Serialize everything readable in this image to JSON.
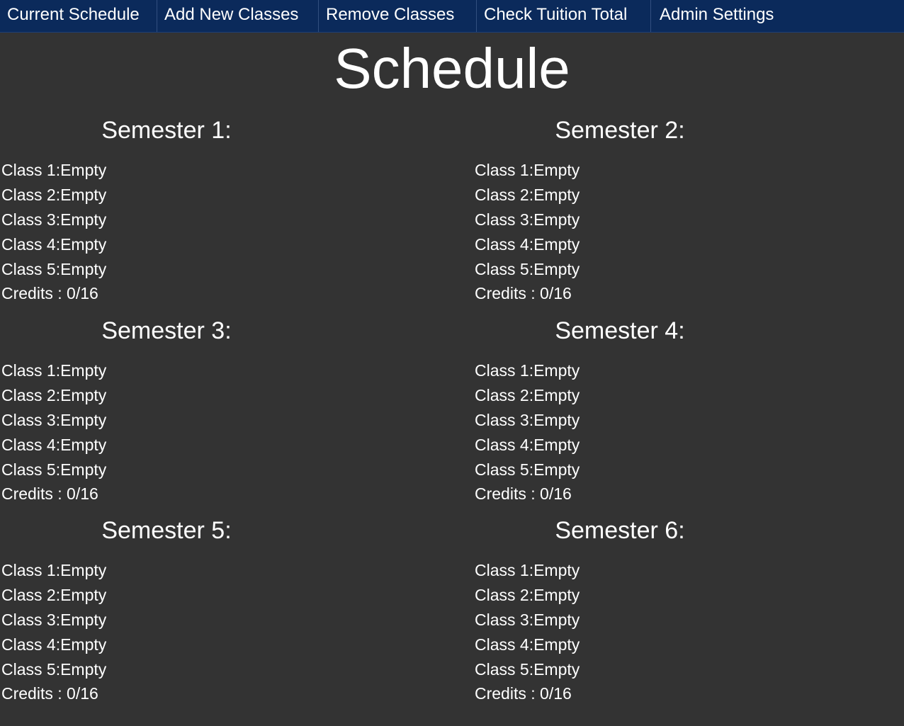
{
  "nav": {
    "items": [
      {
        "label": "Current Schedule"
      },
      {
        "label": "Add New Classes"
      },
      {
        "label": "Remove Classes"
      },
      {
        "label": "Check Tuition Total"
      },
      {
        "label": "Admin Settings"
      }
    ]
  },
  "page": {
    "title": "Schedule"
  },
  "semesters": [
    {
      "title": "Semester 1:",
      "classes": [
        {
          "label": "Class 1:",
          "value": "Empty"
        },
        {
          "label": "Class 2:",
          "value": "Empty"
        },
        {
          "label": "Class 3:",
          "value": "Empty"
        },
        {
          "label": "Class 4:",
          "value": "Empty"
        },
        {
          "label": "Class 5:",
          "value": "Empty"
        }
      ],
      "credits_label": "Credits : ",
      "credits_value": "0/16"
    },
    {
      "title": "Semester 2:",
      "classes": [
        {
          "label": "Class 1:",
          "value": "Empty"
        },
        {
          "label": "Class 2:",
          "value": "Empty"
        },
        {
          "label": "Class 3:",
          "value": "Empty"
        },
        {
          "label": "Class 4:",
          "value": "Empty"
        },
        {
          "label": "Class 5:",
          "value": "Empty"
        }
      ],
      "credits_label": "Credits : ",
      "credits_value": "0/16"
    },
    {
      "title": "Semester 3:",
      "classes": [
        {
          "label": "Class 1:",
          "value": "Empty"
        },
        {
          "label": "Class 2:",
          "value": "Empty"
        },
        {
          "label": "Class 3:",
          "value": "Empty"
        },
        {
          "label": "Class 4:",
          "value": "Empty"
        },
        {
          "label": "Class 5:",
          "value": "Empty"
        }
      ],
      "credits_label": "Credits : ",
      "credits_value": "0/16"
    },
    {
      "title": "Semester 4:",
      "classes": [
        {
          "label": "Class 1:",
          "value": "Empty"
        },
        {
          "label": "Class 2:",
          "value": "Empty"
        },
        {
          "label": "Class 3:",
          "value": "Empty"
        },
        {
          "label": "Class 4:",
          "value": "Empty"
        },
        {
          "label": "Class 5:",
          "value": "Empty"
        }
      ],
      "credits_label": "Credits : ",
      "credits_value": "0/16"
    },
    {
      "title": "Semester 5:",
      "classes": [
        {
          "label": "Class 1:",
          "value": "Empty"
        },
        {
          "label": "Class 2:",
          "value": "Empty"
        },
        {
          "label": "Class 3:",
          "value": "Empty"
        },
        {
          "label": "Class 4:",
          "value": "Empty"
        },
        {
          "label": "Class 5:",
          "value": "Empty"
        }
      ],
      "credits_label": "Credits : ",
      "credits_value": "0/16"
    },
    {
      "title": "Semester 6:",
      "classes": [
        {
          "label": "Class 1:",
          "value": "Empty"
        },
        {
          "label": "Class 2:",
          "value": "Empty"
        },
        {
          "label": "Class 3:",
          "value": "Empty"
        },
        {
          "label": "Class 4:",
          "value": "Empty"
        },
        {
          "label": "Class 5:",
          "value": "Empty"
        }
      ],
      "credits_label": "Credits : ",
      "credits_value": "0/16"
    }
  ],
  "colors": {
    "background": "#333333",
    "navbar": "#0b2a5b",
    "text": "#ffffff"
  }
}
